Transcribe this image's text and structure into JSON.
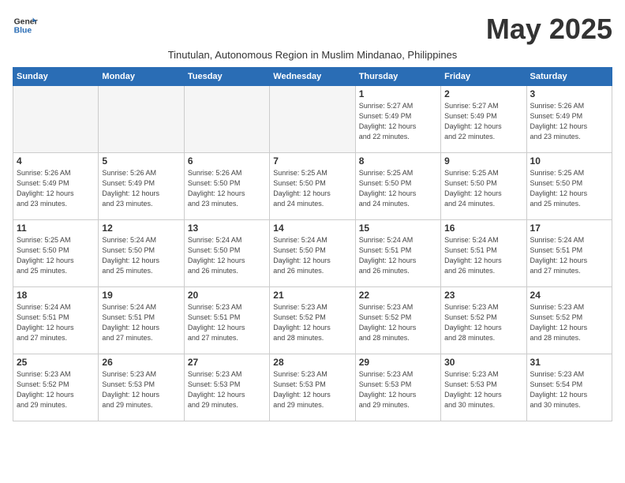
{
  "header": {
    "logo_line1": "General",
    "logo_line2": "Blue",
    "month_title": "May 2025",
    "subtitle": "Tinutulan, Autonomous Region in Muslim Mindanao, Philippines"
  },
  "weekdays": [
    "Sunday",
    "Monday",
    "Tuesday",
    "Wednesday",
    "Thursday",
    "Friday",
    "Saturday"
  ],
  "weeks": [
    [
      {
        "day": "",
        "info": ""
      },
      {
        "day": "",
        "info": ""
      },
      {
        "day": "",
        "info": ""
      },
      {
        "day": "",
        "info": ""
      },
      {
        "day": "1",
        "info": "Sunrise: 5:27 AM\nSunset: 5:49 PM\nDaylight: 12 hours\nand 22 minutes."
      },
      {
        "day": "2",
        "info": "Sunrise: 5:27 AM\nSunset: 5:49 PM\nDaylight: 12 hours\nand 22 minutes."
      },
      {
        "day": "3",
        "info": "Sunrise: 5:26 AM\nSunset: 5:49 PM\nDaylight: 12 hours\nand 23 minutes."
      }
    ],
    [
      {
        "day": "4",
        "info": "Sunrise: 5:26 AM\nSunset: 5:49 PM\nDaylight: 12 hours\nand 23 minutes."
      },
      {
        "day": "5",
        "info": "Sunrise: 5:26 AM\nSunset: 5:49 PM\nDaylight: 12 hours\nand 23 minutes."
      },
      {
        "day": "6",
        "info": "Sunrise: 5:26 AM\nSunset: 5:50 PM\nDaylight: 12 hours\nand 23 minutes."
      },
      {
        "day": "7",
        "info": "Sunrise: 5:25 AM\nSunset: 5:50 PM\nDaylight: 12 hours\nand 24 minutes."
      },
      {
        "day": "8",
        "info": "Sunrise: 5:25 AM\nSunset: 5:50 PM\nDaylight: 12 hours\nand 24 minutes."
      },
      {
        "day": "9",
        "info": "Sunrise: 5:25 AM\nSunset: 5:50 PM\nDaylight: 12 hours\nand 24 minutes."
      },
      {
        "day": "10",
        "info": "Sunrise: 5:25 AM\nSunset: 5:50 PM\nDaylight: 12 hours\nand 25 minutes."
      }
    ],
    [
      {
        "day": "11",
        "info": "Sunrise: 5:25 AM\nSunset: 5:50 PM\nDaylight: 12 hours\nand 25 minutes."
      },
      {
        "day": "12",
        "info": "Sunrise: 5:24 AM\nSunset: 5:50 PM\nDaylight: 12 hours\nand 25 minutes."
      },
      {
        "day": "13",
        "info": "Sunrise: 5:24 AM\nSunset: 5:50 PM\nDaylight: 12 hours\nand 26 minutes."
      },
      {
        "day": "14",
        "info": "Sunrise: 5:24 AM\nSunset: 5:50 PM\nDaylight: 12 hours\nand 26 minutes."
      },
      {
        "day": "15",
        "info": "Sunrise: 5:24 AM\nSunset: 5:51 PM\nDaylight: 12 hours\nand 26 minutes."
      },
      {
        "day": "16",
        "info": "Sunrise: 5:24 AM\nSunset: 5:51 PM\nDaylight: 12 hours\nand 26 minutes."
      },
      {
        "day": "17",
        "info": "Sunrise: 5:24 AM\nSunset: 5:51 PM\nDaylight: 12 hours\nand 27 minutes."
      }
    ],
    [
      {
        "day": "18",
        "info": "Sunrise: 5:24 AM\nSunset: 5:51 PM\nDaylight: 12 hours\nand 27 minutes."
      },
      {
        "day": "19",
        "info": "Sunrise: 5:24 AM\nSunset: 5:51 PM\nDaylight: 12 hours\nand 27 minutes."
      },
      {
        "day": "20",
        "info": "Sunrise: 5:23 AM\nSunset: 5:51 PM\nDaylight: 12 hours\nand 27 minutes."
      },
      {
        "day": "21",
        "info": "Sunrise: 5:23 AM\nSunset: 5:52 PM\nDaylight: 12 hours\nand 28 minutes."
      },
      {
        "day": "22",
        "info": "Sunrise: 5:23 AM\nSunset: 5:52 PM\nDaylight: 12 hours\nand 28 minutes."
      },
      {
        "day": "23",
        "info": "Sunrise: 5:23 AM\nSunset: 5:52 PM\nDaylight: 12 hours\nand 28 minutes."
      },
      {
        "day": "24",
        "info": "Sunrise: 5:23 AM\nSunset: 5:52 PM\nDaylight: 12 hours\nand 28 minutes."
      }
    ],
    [
      {
        "day": "25",
        "info": "Sunrise: 5:23 AM\nSunset: 5:52 PM\nDaylight: 12 hours\nand 29 minutes."
      },
      {
        "day": "26",
        "info": "Sunrise: 5:23 AM\nSunset: 5:53 PM\nDaylight: 12 hours\nand 29 minutes."
      },
      {
        "day": "27",
        "info": "Sunrise: 5:23 AM\nSunset: 5:53 PM\nDaylight: 12 hours\nand 29 minutes."
      },
      {
        "day": "28",
        "info": "Sunrise: 5:23 AM\nSunset: 5:53 PM\nDaylight: 12 hours\nand 29 minutes."
      },
      {
        "day": "29",
        "info": "Sunrise: 5:23 AM\nSunset: 5:53 PM\nDaylight: 12 hours\nand 29 minutes."
      },
      {
        "day": "30",
        "info": "Sunrise: 5:23 AM\nSunset: 5:53 PM\nDaylight: 12 hours\nand 30 minutes."
      },
      {
        "day": "31",
        "info": "Sunrise: 5:23 AM\nSunset: 5:54 PM\nDaylight: 12 hours\nand 30 minutes."
      }
    ]
  ]
}
